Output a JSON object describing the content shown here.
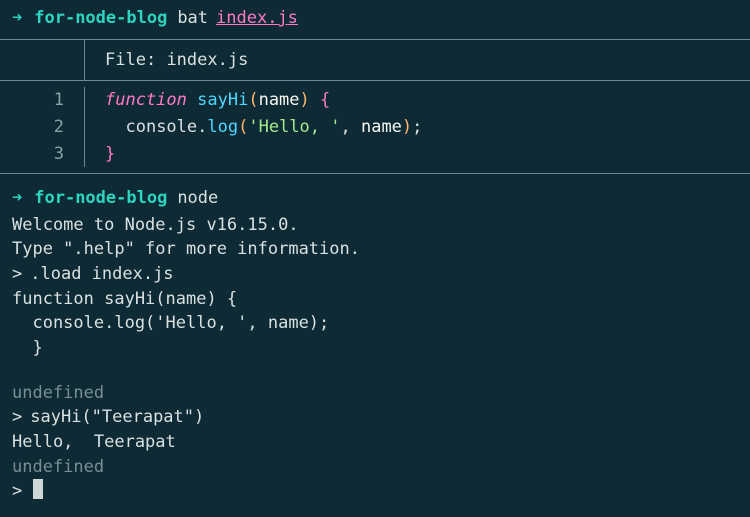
{
  "prompt1": {
    "arrow": "➜",
    "dir": "for-node-blog",
    "cmd": "bat",
    "arg": "index.js"
  },
  "bat": {
    "file_label": "File:",
    "file_name": "index.js",
    "lines": {
      "l1": "1",
      "l2": "2",
      "l3": "3"
    },
    "code": {
      "l1": {
        "kw": "function",
        "fn": "sayHi",
        "po": "(",
        "param": "name",
        "pc": ")",
        "bo": "{"
      },
      "l2": {
        "indent": "  ",
        "obj": "console",
        "dot": ".",
        "method": "log",
        "po": "(",
        "str": "'Hello, '",
        "comma": ", ",
        "ident": "name",
        "pc": ")",
        "semi": ";"
      },
      "l3": {
        "bc": "}"
      }
    }
  },
  "prompt2": {
    "arrow": "➜",
    "dir": "for-node-blog",
    "cmd": "node"
  },
  "repl": {
    "welcome": "Welcome to Node.js v16.15.0.",
    "help": "Type \".help\" for more information.",
    "load_caret": ">",
    "load_cmd": ".load index.js",
    "echo1": "function sayHi(name) {",
    "echo2": "  console.log('Hello, ', name);",
    "echo3": "  }",
    "undef1": "undefined",
    "call_caret": ">",
    "call_cmd": "sayHi(\"Teerapat\")",
    "output": "Hello,  Teerapat",
    "undef2": "undefined",
    "final_caret": ">"
  }
}
